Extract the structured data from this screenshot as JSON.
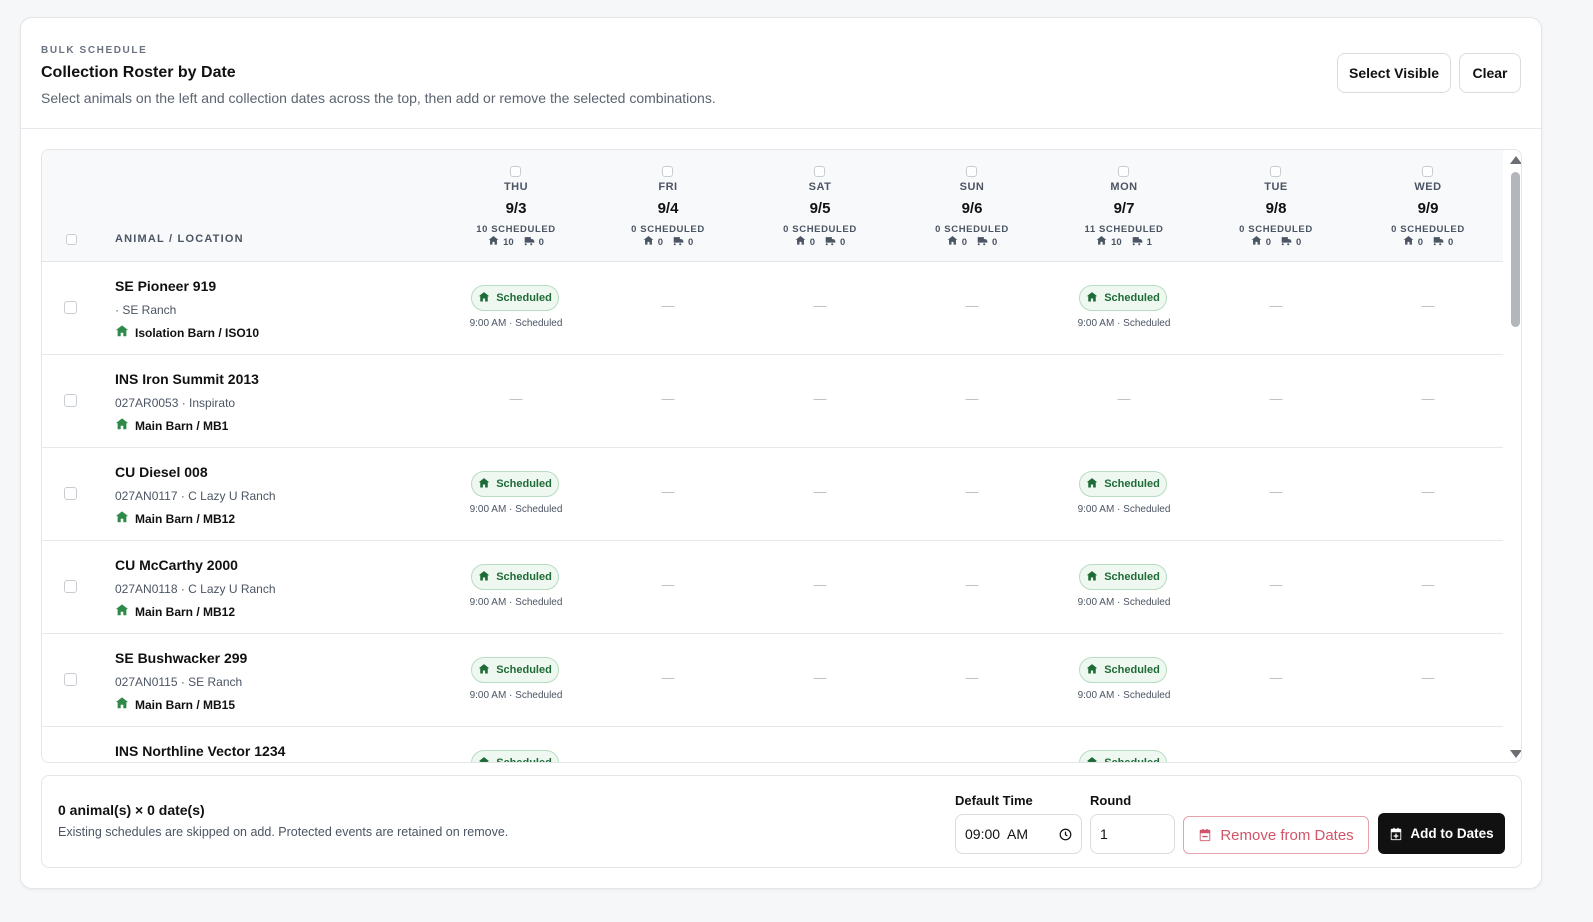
{
  "header": {
    "eyebrow": "BULK SCHEDULE",
    "title": "Collection Roster by Date",
    "subtitle": "Select animals on the left and collection dates across the top, then add or remove the selected combinations.",
    "select_visible_label": "Select Visible",
    "clear_label": "Clear"
  },
  "grid": {
    "column_header": "ANIMAL / LOCATION",
    "dates": [
      {
        "dow": "THU",
        "date": "9/3",
        "scheduled": "10 SCHEDULED",
        "barn": "10",
        "truck": "0"
      },
      {
        "dow": "FRI",
        "date": "9/4",
        "scheduled": "0 SCHEDULED",
        "barn": "0",
        "truck": "0"
      },
      {
        "dow": "SAT",
        "date": "9/5",
        "scheduled": "0 SCHEDULED",
        "barn": "0",
        "truck": "0"
      },
      {
        "dow": "SUN",
        "date": "9/6",
        "scheduled": "0 SCHEDULED",
        "barn": "0",
        "truck": "0"
      },
      {
        "dow": "MON",
        "date": "9/7",
        "scheduled": "11 SCHEDULED",
        "barn": "10",
        "truck": "1"
      },
      {
        "dow": "TUE",
        "date": "9/8",
        "scheduled": "0 SCHEDULED",
        "barn": "0",
        "truck": "0"
      },
      {
        "dow": "WED",
        "date": "9/9",
        "scheduled": "0 SCHEDULED",
        "barn": "0",
        "truck": "0"
      }
    ],
    "scheduled_label": "Scheduled",
    "scheduled_time": "9:00 AM · Scheduled",
    "empty_mark": "—",
    "rows": [
      {
        "name": "SE Pioneer 919",
        "sub": "· SE Ranch",
        "location": "Isolation Barn / ISO10",
        "scheduled": [
          true,
          false,
          false,
          false,
          true,
          false,
          false
        ]
      },
      {
        "name": "INS Iron Summit 2013",
        "sub": "027AR0053 · Inspirato",
        "location": "Main Barn / MB1",
        "scheduled": [
          false,
          false,
          false,
          false,
          false,
          false,
          false
        ]
      },
      {
        "name": "CU Diesel 008",
        "sub": "027AN0117 · C Lazy U Ranch",
        "location": "Main Barn / MB12",
        "scheduled": [
          true,
          false,
          false,
          false,
          true,
          false,
          false
        ]
      },
      {
        "name": "CU McCarthy 2000",
        "sub": "027AN0118 · C Lazy U Ranch",
        "location": "Main Barn / MB12",
        "scheduled": [
          true,
          false,
          false,
          false,
          true,
          false,
          false
        ]
      },
      {
        "name": "SE Bushwacker 299",
        "sub": "027AN0115 · SE Ranch",
        "location": "Main Barn / MB15",
        "scheduled": [
          true,
          false,
          false,
          false,
          true,
          false,
          false
        ]
      },
      {
        "name": "INS Northline Vector 1234",
        "sub": "",
        "location": "",
        "scheduled": [
          true,
          false,
          false,
          false,
          true,
          false,
          false
        ]
      }
    ]
  },
  "footer": {
    "summary": "0 animal(s) × 0 date(s)",
    "note": "Existing schedules are skipped on add. Protected events are retained on remove.",
    "default_time_label": "Default Time",
    "default_time_value": "09:00  AM",
    "round_label": "Round",
    "round_value": "1",
    "remove_label": "Remove from Dates",
    "add_label": "Add to Dates"
  },
  "colors": {
    "accent_green": "#2f8a4a",
    "remove_red": "#d0556a",
    "primary_dark": "#111111"
  },
  "icons": [
    "barn-icon",
    "truck-icon",
    "clock-icon",
    "calendar-minus-icon",
    "calendar-plus-icon"
  ]
}
